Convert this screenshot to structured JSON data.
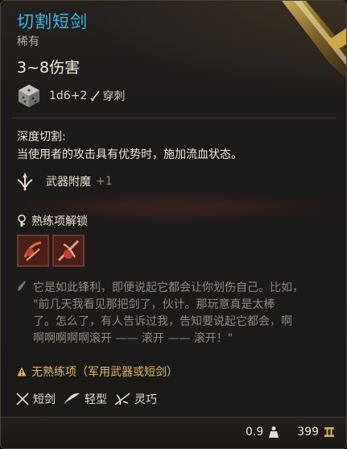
{
  "item": {
    "name": "切割短剑",
    "rarity": "稀有",
    "damage": "3~8伤害",
    "dice_roll": "1d6+2",
    "damage_type": "穿刺"
  },
  "passive": {
    "title": "深度切割:",
    "description": "当使用者的攻击具有优势时，施加流血状态。"
  },
  "enchantment": {
    "label": "武器附魔",
    "value": "+1"
  },
  "proficiency": {
    "unlock_label": "熟练项解锁",
    "warning": "无熟练项（军用武器或短剑）"
  },
  "flavor_lines": [
    "它是如此锋利，即便说起它都会让你划伤自己。比如，",
    "\"前几天我看见那把剑了，伙计。那玩意真是太棒",
    "了。怎么了，有人告诉过我，告知要说起它都会，啊",
    "啊啊啊啊啊滚开 —— 滚开 —— 滚开！\""
  ],
  "properties": [
    {
      "label": "短剑",
      "icon": "crossed-swords-icon"
    },
    {
      "label": "轻型",
      "icon": "feather-icon"
    },
    {
      "label": "灵巧",
      "icon": "finesse-icon"
    }
  ],
  "footer": {
    "weight": "0.9",
    "value": "399"
  },
  "colors": {
    "name": "#3fb7e8",
    "warning": "#e0b66a",
    "muted": "#8f877c"
  }
}
